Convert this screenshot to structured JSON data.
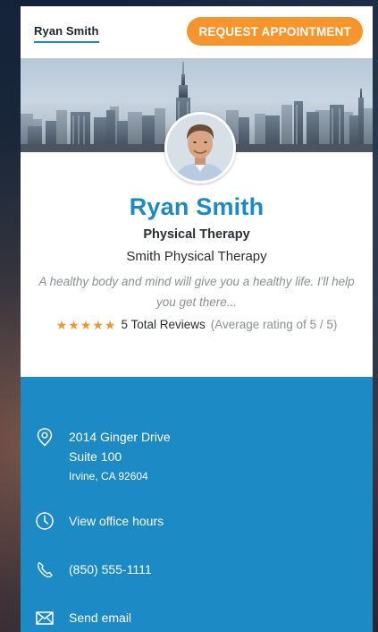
{
  "header": {
    "name_tab": "Ryan Smith",
    "request_button": "REQUEST APPOINTMENT"
  },
  "profile": {
    "name": "Ryan Smith",
    "specialty": "Physical Therapy",
    "practice": "Smith Physical Therapy",
    "tagline": "A healthy body and mind will give you a healthy life. I'll help you get there...",
    "rating": 5,
    "rating_max": 5,
    "reviews_text": "5 Total Reviews",
    "average_text": "(Average rating of 5 / 5)"
  },
  "contact": {
    "address_line1": "2014 Ginger Drive",
    "address_line2": "Suite 100",
    "address_line3": "Irvine, CA 92604",
    "hours_link": "View office hours",
    "phone": "(850) 555-1111",
    "email_link": "Send email"
  },
  "colors": {
    "accent_blue": "#1c8ac4",
    "accent_orange": "#f5952c"
  },
  "icons": {
    "address": "location-pin-icon",
    "hours": "clock-icon",
    "phone": "phone-icon",
    "email": "envelope-icon",
    "rating": "star-icon"
  }
}
